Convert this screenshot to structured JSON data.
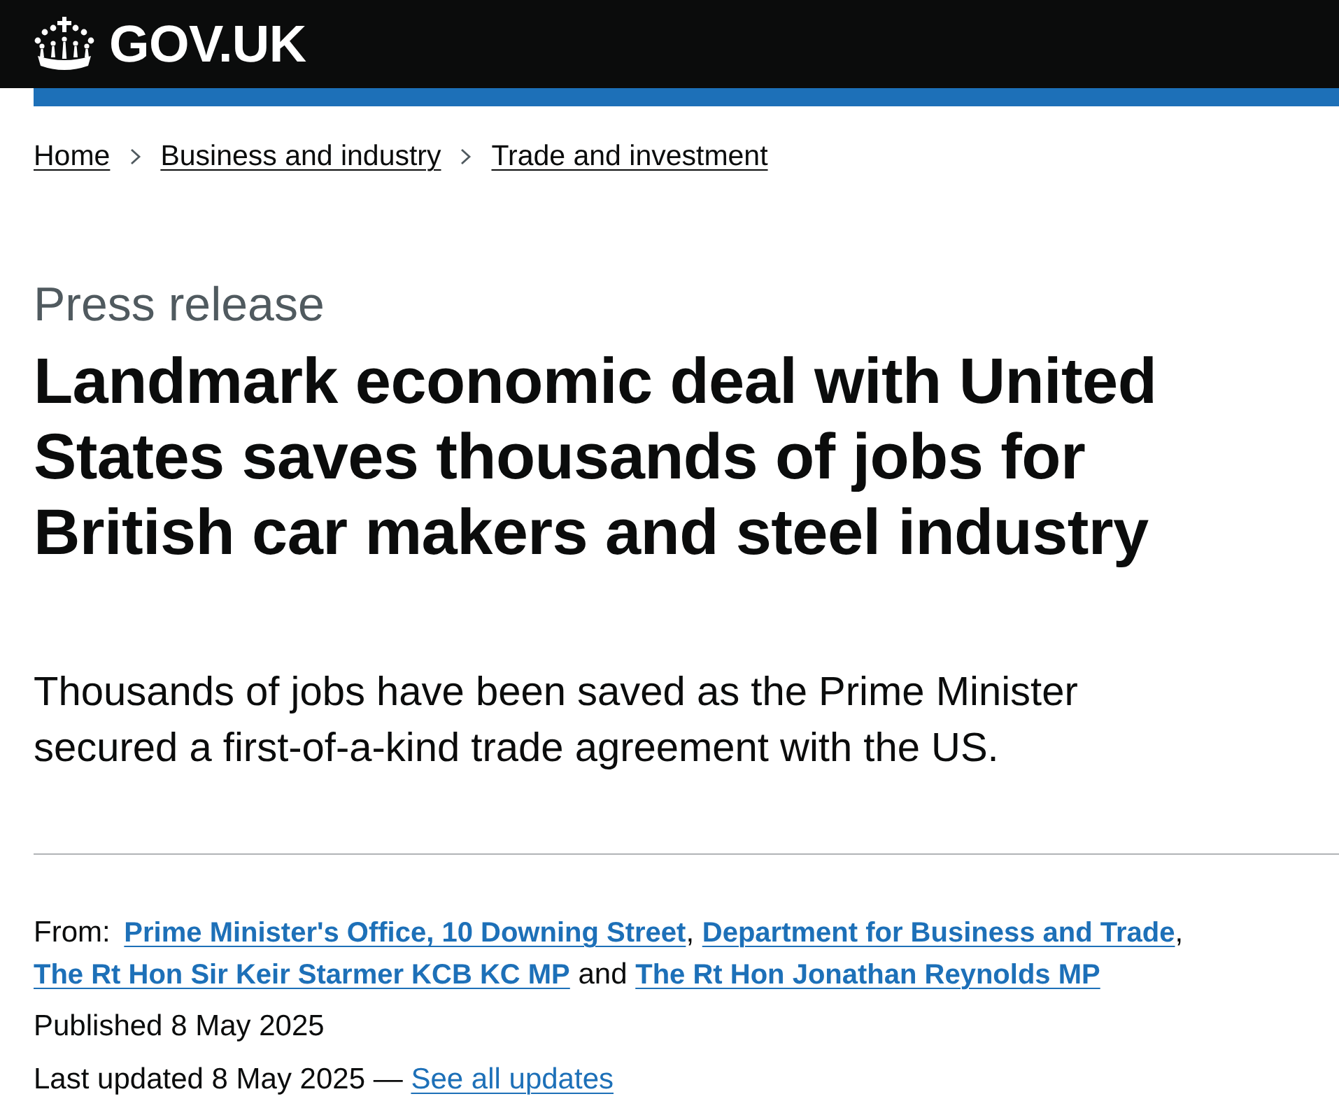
{
  "header": {
    "logo_text": "GOV.UK"
  },
  "breadcrumbs": [
    {
      "label": "Home"
    },
    {
      "label": "Business and industry"
    },
    {
      "label": "Trade and investment"
    }
  ],
  "document_type": "Press release",
  "title": "Landmark economic deal with United States saves thousands of jobs for British car makers and steel industry",
  "lead": "Thousands of jobs have been saved as the Prime Minister secured a first-of-a-kind trade agreement with the US.",
  "metadata": {
    "from_label": "From:",
    "from": [
      {
        "label": "Prime Minister's Office, 10 Downing Street",
        "separator_after": ","
      },
      {
        "label": "Department for Business and Trade",
        "separator_after": ","
      },
      {
        "label": "The Rt Hon Sir Keir Starmer KCB KC MP",
        "separator_after": "and"
      },
      {
        "label": "The Rt Hon Jonathan Reynolds MP"
      }
    ],
    "published": {
      "label": "Published",
      "value": "8 May 2025"
    },
    "last_updated": {
      "label": "Last updated",
      "value": "8 May 2025",
      "dash": "—",
      "link": "See all updates"
    }
  }
}
